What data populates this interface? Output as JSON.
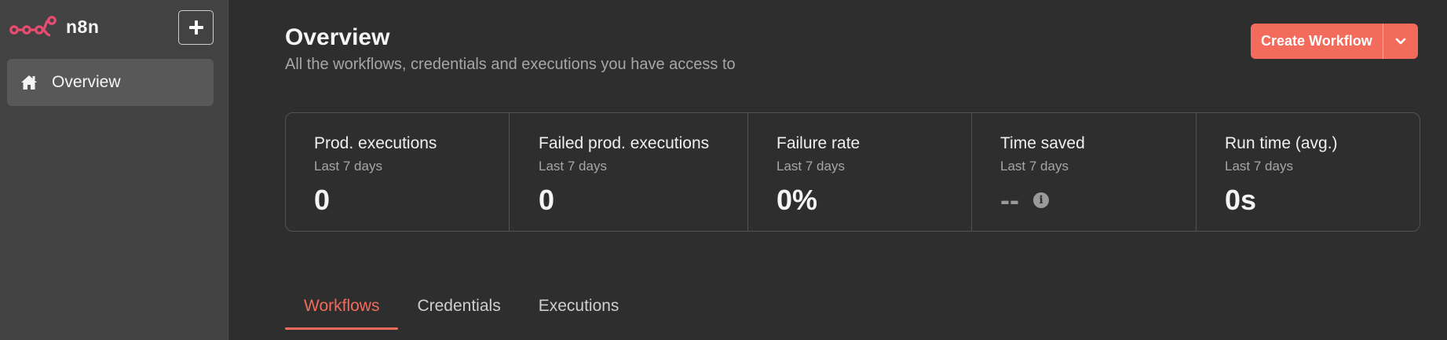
{
  "brand": {
    "name": "n8n",
    "color": "#ea4b71"
  },
  "sidebar": {
    "add_icon": "plus-icon",
    "items": [
      {
        "label": "Overview",
        "icon": "home-icon",
        "active": true
      }
    ]
  },
  "header": {
    "title": "Overview",
    "subtitle": "All the workflows, credentials and executions you have access to",
    "create_label": "Create Workflow",
    "accent": "#f26b5b"
  },
  "stats": [
    {
      "title": "Prod. executions",
      "period": "Last 7 days",
      "value": "0"
    },
    {
      "title": "Failed prod. executions",
      "period": "Last 7 days",
      "value": "0"
    },
    {
      "title": "Failure rate",
      "period": "Last 7 days",
      "value": "0%"
    },
    {
      "title": "Time saved",
      "period": "Last 7 days",
      "value": "--",
      "icon": "info-icon"
    },
    {
      "title": "Run time (avg.)",
      "period": "Last 7 days",
      "value": "0s"
    }
  ],
  "tabs": [
    {
      "label": "Workflows",
      "active": true
    },
    {
      "label": "Credentials",
      "active": false
    },
    {
      "label": "Executions",
      "active": false
    }
  ]
}
